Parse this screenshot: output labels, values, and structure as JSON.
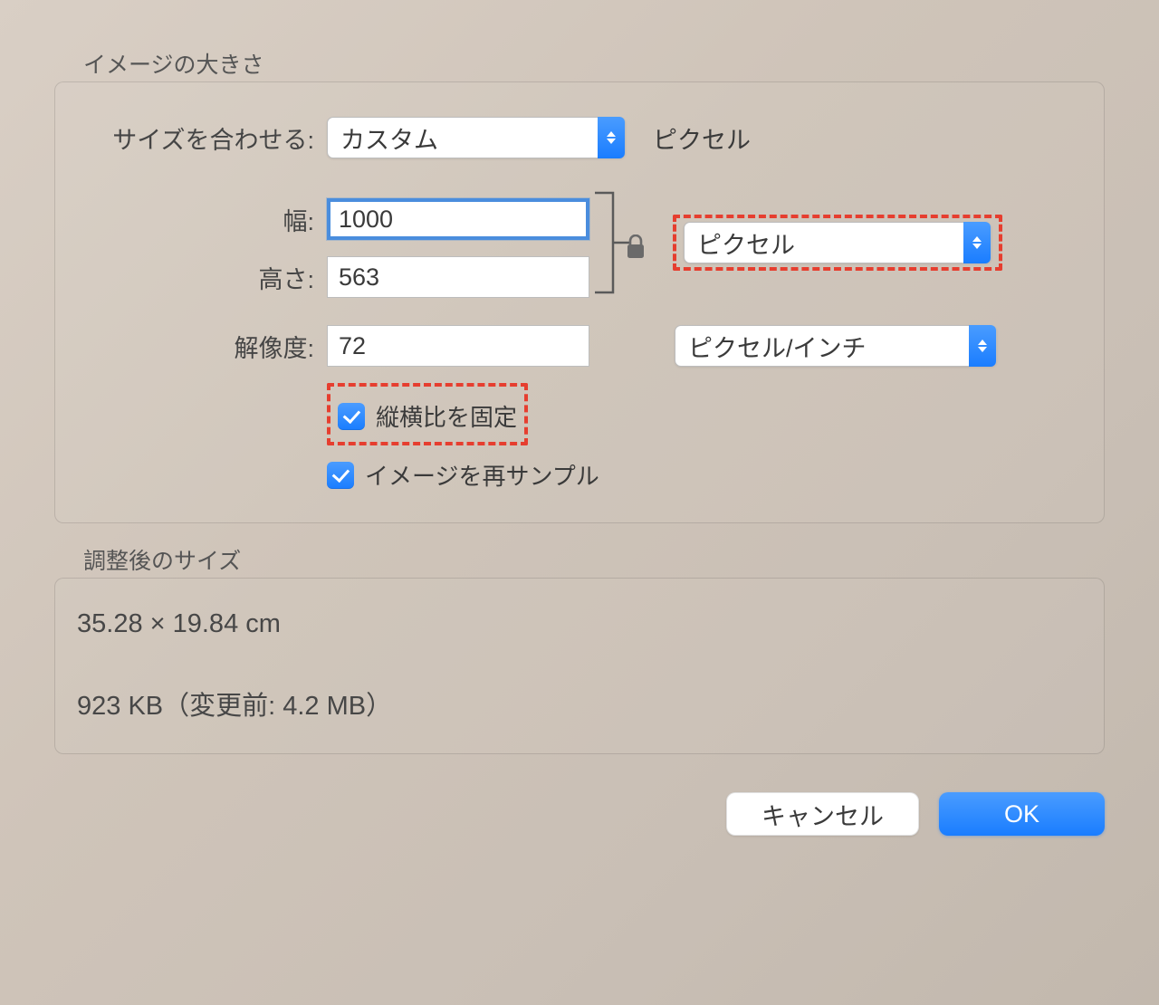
{
  "imageSize": {
    "groupTitle": "イメージの大きさ",
    "fitLabel": "サイズを合わせる:",
    "fitSelect": "カスタム",
    "fitUnitText": "ピクセル",
    "widthLabel": "幅:",
    "widthValue": "1000",
    "heightLabel": "高さ:",
    "heightValue": "563",
    "pixelUnitSelect": "ピクセル",
    "resolutionLabel": "解像度:",
    "resolutionValue": "72",
    "resolutionUnitSelect": "ピクセル/インチ",
    "constrainLabel": "縦横比を固定",
    "resampleLabel": "イメージを再サンプル"
  },
  "resultingSize": {
    "groupTitle": "調整後のサイズ",
    "dimensions": "35.28 × 19.84 cm",
    "fileSize": "923 KB（変更前: 4.2 MB）"
  },
  "buttons": {
    "cancel": "キャンセル",
    "ok": "OK"
  }
}
